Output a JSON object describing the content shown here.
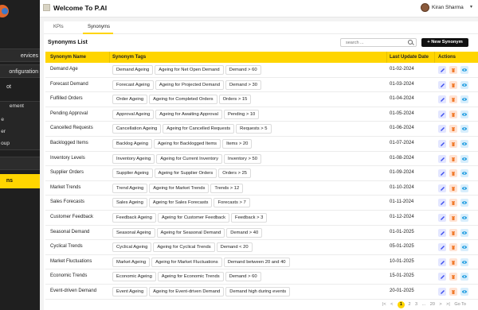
{
  "header": {
    "title": "Welcome To P.AI",
    "user_name": "Kiran Sharma"
  },
  "sidebar": {
    "items": [
      {
        "label": "ervices"
      },
      {
        "label": "onfiguration"
      },
      {
        "label": "ot"
      },
      {
        "label": "ement"
      },
      {
        "label": "e"
      },
      {
        "label": "er"
      },
      {
        "label": "oup"
      },
      {
        "label": "ns"
      }
    ]
  },
  "tabs": [
    {
      "label": "KPIs"
    },
    {
      "label": "Synonyms"
    }
  ],
  "list": {
    "title": "Synonyms List",
    "search_placeholder": "search ...",
    "new_button": "New Synonym"
  },
  "table": {
    "columns": [
      "Synonym Name",
      "Synonym Tags",
      "Last Update Date",
      "Actions"
    ],
    "rows": [
      {
        "name": "Demand Age",
        "tags": [
          "Demand Ageing",
          "Ageing for Net Open Demand",
          "Demand > 60"
        ],
        "date": "01-02-2024"
      },
      {
        "name": "Forecast Demand",
        "tags": [
          "Forecast Ageing",
          "Ageing for Projected Demand",
          "Demand > 30"
        ],
        "date": "01-03-2024"
      },
      {
        "name": "Fulfilled Orders",
        "tags": [
          "Order Ageing",
          "Ageing for Completed Orders",
          "Orders > 15"
        ],
        "date": "01-04-2024"
      },
      {
        "name": "Pending Approval",
        "tags": [
          "Approval Ageing",
          "Ageing for Awaiting Approval",
          "Pending > 10"
        ],
        "date": "01-05-2024"
      },
      {
        "name": "Cancelled Requests",
        "tags": [
          "Cancellation Ageing",
          "Ageing for Cancelled Requests",
          "Requests > 5"
        ],
        "date": "01-06-2024"
      },
      {
        "name": "Backlogged Items",
        "tags": [
          "Backlog Ageing",
          "Ageing for Backlogged Items",
          "Items > 20"
        ],
        "date": "01-07-2024"
      },
      {
        "name": "Inventory Levels",
        "tags": [
          "Inventory Ageing",
          "Ageing for Current Inventory",
          "Inventory > 50"
        ],
        "date": "01-08-2024"
      },
      {
        "name": "Supplier Orders",
        "tags": [
          "Supplier Ageing",
          "Ageing for Supplier Orders",
          "Orders > 25"
        ],
        "date": "01-09-2024"
      },
      {
        "name": "Market Trends",
        "tags": [
          "Trend Ageing",
          "Ageing for Market Trends",
          "Trends > 12"
        ],
        "date": "01-10-2024"
      },
      {
        "name": "Sales Forecasts",
        "tags": [
          "Sales Ageing",
          "Ageing for Sales Forecasts",
          "Forecasts > 7"
        ],
        "date": "01-11-2024"
      },
      {
        "name": "Customer Feedback",
        "tags": [
          "Feedback Ageing",
          "Ageing for Customer Feedback",
          "Feedback > 3"
        ],
        "date": "01-12-2024"
      },
      {
        "name": "Seasonal Demand",
        "tags": [
          "Seasonal Ageing",
          "Ageing for Seasonal Demand",
          "Demand > 40"
        ],
        "date": "01-01-2025"
      },
      {
        "name": "Cyclical Trends",
        "tags": [
          "Cyclical Ageing",
          "Ageing for Cyclical Trends",
          "Demand < 20"
        ],
        "date": "05-01-2025"
      },
      {
        "name": "Market Fluctuations",
        "tags": [
          "Market Ageing",
          "Ageing for Market Fluctuations",
          "Demand between 20 and 40"
        ],
        "date": "10-01-2025"
      },
      {
        "name": "Economic Trends",
        "tags": [
          "Economic Ageing",
          "Ageing for Economic Trends",
          "Demand > 60"
        ],
        "date": "15-01-2025"
      },
      {
        "name": "Event-driven Demand",
        "tags": [
          "Event Ageing",
          "Ageing for Event-driven Demand",
          "Demand high during events"
        ],
        "date": "20-01-2025"
      }
    ]
  },
  "pagination": {
    "prev_first": "|<",
    "prev": "<",
    "current": "1",
    "page2": "2",
    "page3": "3",
    "ellipsis": "...",
    "last": "20",
    "next": ">",
    "next_last": ">|",
    "goto_label": "Go To"
  },
  "colors": {
    "accent": "#ffd500",
    "sidebar": "#1f1f1f",
    "edit": "#3b4cf0",
    "delete": "#f07a2a",
    "view": "#1e9be0"
  }
}
